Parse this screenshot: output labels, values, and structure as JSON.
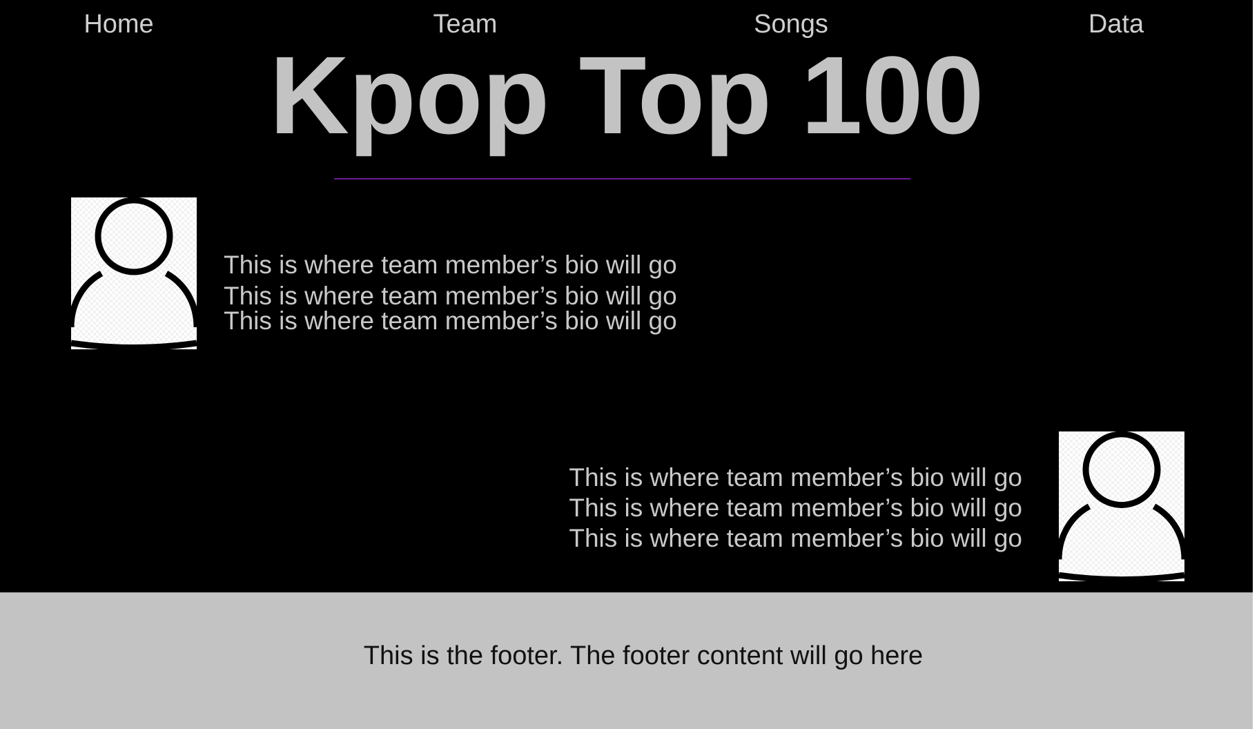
{
  "nav": {
    "items": [
      {
        "label": "Home"
      },
      {
        "label": "Team"
      },
      {
        "label": "Songs"
      },
      {
        "label": "Data"
      }
    ]
  },
  "header": {
    "title": "Kpop Top 100",
    "divider_color": "#6a1b9a"
  },
  "team": {
    "members": [
      {
        "avatar_icon": "person-placeholder-icon",
        "bio_lines": [
          "This is where team member’s bio will go",
          "This is where team member’s bio will go",
          "This is where team member’s bio will go"
        ]
      },
      {
        "avatar_icon": "person-placeholder-icon",
        "bio_lines": [
          "This is where team member’s bio will go",
          "This is where team member’s bio will go",
          "This is where team member’s bio will go"
        ]
      }
    ]
  },
  "footer": {
    "text": "This is the footer. The footer content will go here"
  },
  "colors": {
    "background": "#000000",
    "text": "#c9c9c9",
    "footer_background": "#c3c3c3"
  }
}
